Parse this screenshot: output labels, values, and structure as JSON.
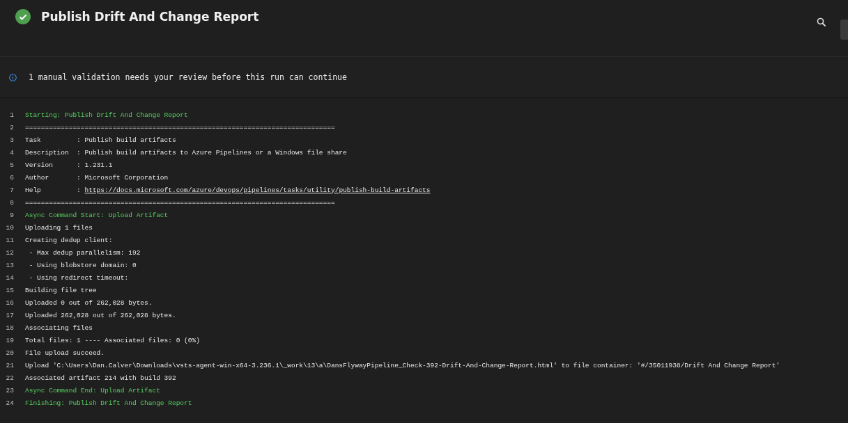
{
  "header": {
    "title": "Publish Drift And Change Report",
    "succeeded": true
  },
  "banner": {
    "message": "1 manual validation needs your review before this run can continue"
  },
  "log": [
    {
      "number": "1",
      "kind": "section",
      "text": "Starting: Publish Drift And Change Report"
    },
    {
      "number": "2",
      "kind": "plain",
      "text": "=============================================================================="
    },
    {
      "number": "3",
      "kind": "plain",
      "text": "Task         : Publish build artifacts"
    },
    {
      "number": "4",
      "kind": "plain",
      "text": "Description  : Publish build artifacts to Azure Pipelines or a Windows file share"
    },
    {
      "number": "5",
      "kind": "plain",
      "text": "Version      : 1.231.1"
    },
    {
      "number": "6",
      "kind": "plain",
      "text": "Author       : Microsoft Corporation"
    },
    {
      "number": "7",
      "kind": "link",
      "text": "Help         : ",
      "link": "https://docs.microsoft.com/azure/devops/pipelines/tasks/utility/publish-build-artifacts"
    },
    {
      "number": "8",
      "kind": "plain",
      "text": "=============================================================================="
    },
    {
      "number": "9",
      "kind": "section",
      "text": "Async Command Start: Upload Artifact"
    },
    {
      "number": "10",
      "kind": "plain",
      "text": "Uploading 1 files"
    },
    {
      "number": "11",
      "kind": "plain",
      "text": "Creating dedup client:"
    },
    {
      "number": "12",
      "kind": "plain",
      "text": " - Max dedup parallelism: 192"
    },
    {
      "number": "13",
      "kind": "plain",
      "text": " - Using blobstore domain: 0"
    },
    {
      "number": "14",
      "kind": "plain",
      "text": " - Using redirect timeout:"
    },
    {
      "number": "15",
      "kind": "plain",
      "text": "Building file tree"
    },
    {
      "number": "16",
      "kind": "plain",
      "text": "Uploaded 0 out of 262,028 bytes."
    },
    {
      "number": "17",
      "kind": "plain",
      "text": "Uploaded 262,028 out of 262,028 bytes."
    },
    {
      "number": "18",
      "kind": "plain",
      "text": "Associating files"
    },
    {
      "number": "19",
      "kind": "plain",
      "text": "Total files: 1 ---- Associated files: 0 (0%)"
    },
    {
      "number": "20",
      "kind": "plain",
      "text": "File upload succeed."
    },
    {
      "number": "21",
      "kind": "plain",
      "text": "Upload 'C:\\Users\\Dan.Calver\\Downloads\\vsts-agent-win-x64-3.236.1\\_work\\13\\a\\DansFlywayPipeline_Check-392-Drift-And-Change-Report.html' to file container: '#/35011938/Drift And Change Report'"
    },
    {
      "number": "22",
      "kind": "plain",
      "text": "Associated artifact 214 with build 392"
    },
    {
      "number": "23",
      "kind": "section",
      "text": "Async Command End: Upload Artifact"
    },
    {
      "number": "24",
      "kind": "section",
      "text": "Finishing: Publish Drift And Change Report"
    }
  ]
}
